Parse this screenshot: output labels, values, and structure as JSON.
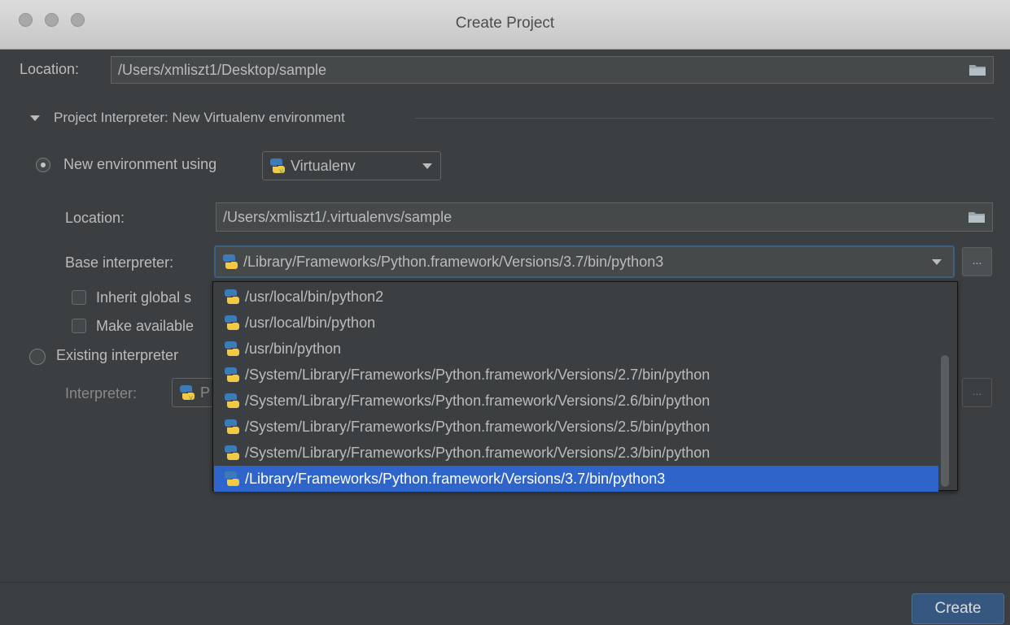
{
  "window": {
    "title": "Create Project"
  },
  "project": {
    "location_label": "Location:",
    "location_value": "/Users/xmliszt1/Desktop/sample"
  },
  "interpreter_section": {
    "title": "Project Interpreter: New Virtualenv environment"
  },
  "new_env": {
    "radio_label": "New environment using",
    "tool_value": "Virtualenv",
    "location_label": "Location:",
    "location_value": "/Users/xmliszt1/.virtualenvs/sample",
    "base_label": "Base interpreter:",
    "base_value": "/Library/Frameworks/Python.framework/Versions/3.7/bin/python3",
    "inherit_label": "Inherit global s",
    "make_available_label": "Make available",
    "dots_label": "..."
  },
  "existing": {
    "radio_label": "Existing interpreter",
    "interpreter_label": "Interpreter:",
    "interpreter_value": "P",
    "dots_label": "..."
  },
  "dropdown_options": [
    "/usr/local/bin/python2",
    "/usr/local/bin/python",
    "/usr/bin/python",
    "/System/Library/Frameworks/Python.framework/Versions/2.7/bin/python",
    "/System/Library/Frameworks/Python.framework/Versions/2.6/bin/python",
    "/System/Library/Frameworks/Python.framework/Versions/2.5/bin/python",
    "/System/Library/Frameworks/Python.framework/Versions/2.3/bin/python",
    "/Library/Frameworks/Python.framework/Versions/3.7/bin/python3"
  ],
  "selected_option_index": 7,
  "footer": {
    "create_label": "Create"
  },
  "colors": {
    "background": "#3c3f41",
    "selection": "#2f65ca",
    "primary_button": "#365880"
  }
}
